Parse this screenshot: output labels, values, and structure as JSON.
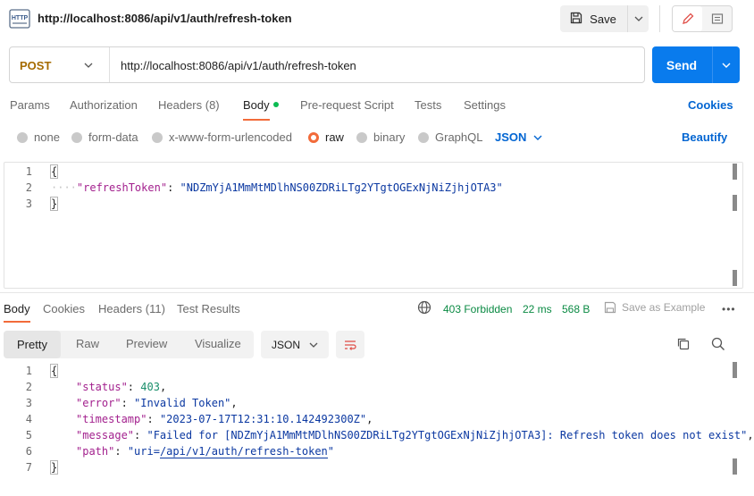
{
  "header": {
    "title": "http://localhost:8086/api/v1/auth/refresh-token",
    "save_label": "Save"
  },
  "request": {
    "method": "POST",
    "url": "http://localhost:8086/api/v1/auth/refresh-token",
    "send_label": "Send"
  },
  "tabs": {
    "params": "Params",
    "authorization": "Authorization",
    "headers": "Headers (8)",
    "body": "Body",
    "prerequest": "Pre-request Script",
    "tests": "Tests",
    "settings": "Settings",
    "cookies": "Cookies"
  },
  "body_types": {
    "none": "none",
    "form_data": "form-data",
    "urlencoded": "x-www-form-urlencoded",
    "raw": "raw",
    "binary": "binary",
    "graphql": "GraphQL",
    "format": "JSON",
    "beautify": "Beautify",
    "selected": "raw"
  },
  "request_body": {
    "line_numbers": [
      "1",
      "2",
      "3"
    ],
    "open_brace": "{",
    "key": "\"refreshToken\"",
    "colon": ": ",
    "value": "\"NDZmYjA1MmMtMDlhNS00ZDRiLTg2YTgtOGExNjNiZjhjOTA3\"",
    "close_brace": "}"
  },
  "response_tabs": {
    "body": "Body",
    "cookies": "Cookies",
    "headers": "Headers (11)",
    "test_results": "Test Results"
  },
  "response_status": {
    "status": "403 Forbidden",
    "time": "22 ms",
    "size": "568 B",
    "save_example": "Save as Example",
    "status_color": "#0a8a43"
  },
  "response_view": {
    "pretty": "Pretty",
    "raw": "Raw",
    "preview": "Preview",
    "visualize": "Visualize",
    "format": "JSON"
  },
  "response_body": {
    "line_numbers": [
      "1",
      "2",
      "3",
      "4",
      "5",
      "6",
      "7"
    ],
    "open_brace": "{",
    "close_brace": "}",
    "status_key": "\"status\"",
    "status_value": "403",
    "error_key": "\"error\"",
    "error_value": "\"Invalid Token\"",
    "timestamp_key": "\"timestamp\"",
    "timestamp_value": "\"2023-07-17T12:31:10.142492300Z\"",
    "message_key": "\"message\"",
    "message_value": "\"Failed for [NDZmYjA1MmMtMDlhNS00ZDRiLTg2YTgtOGExNjNiZjhjOTA3]: Refresh token does not exist\"",
    "path_key": "\"path\"",
    "path_prefix": "\"uri=",
    "path_link": "/api/v1/auth/refresh-token",
    "path_suffix": "\""
  },
  "colors": {
    "accent": "#f26b3a",
    "send_blue": "#097bed",
    "link_blue": "#0265d2",
    "method_orange": "#a56b00"
  }
}
